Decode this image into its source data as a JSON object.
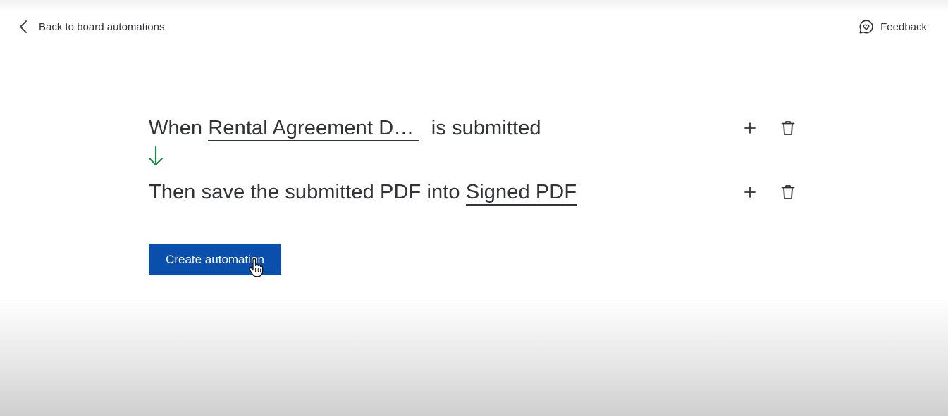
{
  "header": {
    "back_label": "Back to board automations",
    "back_icon": "chevron-left-icon",
    "feedback_label": "Feedback",
    "feedback_icon": "heart-chat-icon"
  },
  "rules": [
    {
      "prefix": "When ",
      "field": "Rental Agreement D…",
      "suffix": "  is submitted",
      "add_icon": "plus-icon",
      "delete_icon": "trash-icon"
    },
    {
      "prefix": "Then save the submitted PDF into ",
      "field": "Signed PDF",
      "suffix": "",
      "add_icon": "plus-icon",
      "delete_icon": "trash-icon"
    }
  ],
  "connector_icon": "arrow-down-icon",
  "colors": {
    "accent": "#0b4fac",
    "connector": "#1f8a4c",
    "text": "#323338"
  },
  "actions": {
    "create_label": "Create automation"
  }
}
